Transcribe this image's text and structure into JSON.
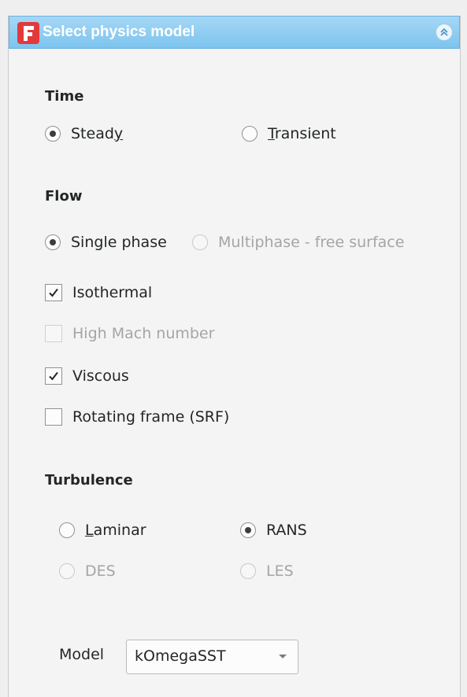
{
  "panel": {
    "title": "Select physics model"
  },
  "time": {
    "heading": "Time",
    "steady": {
      "pre": "Stead",
      "mnemonic": "y",
      "post": ""
    },
    "transient": {
      "pre": "",
      "mnemonic": "T",
      "post": "ransient"
    }
  },
  "flow": {
    "heading": "Flow",
    "single_phase": "Single phase",
    "multiphase": "Multiphase - free surface",
    "isothermal": "Isothermal",
    "high_mach": "High Mach number",
    "viscous": "Viscous",
    "rotating": "Rotating frame (SRF)"
  },
  "turbulence": {
    "heading": "Turbulence",
    "laminar": {
      "pre": "",
      "mnemonic": "L",
      "post": "aminar"
    },
    "rans": "RANS",
    "des": "DES",
    "les": "LES",
    "model_label": "Model",
    "model_value": "kOmegaSST"
  },
  "colors": {
    "header_top": "#a6d7f5",
    "header_bottom": "#7cc4ee",
    "logo_red": "#e2393b"
  }
}
